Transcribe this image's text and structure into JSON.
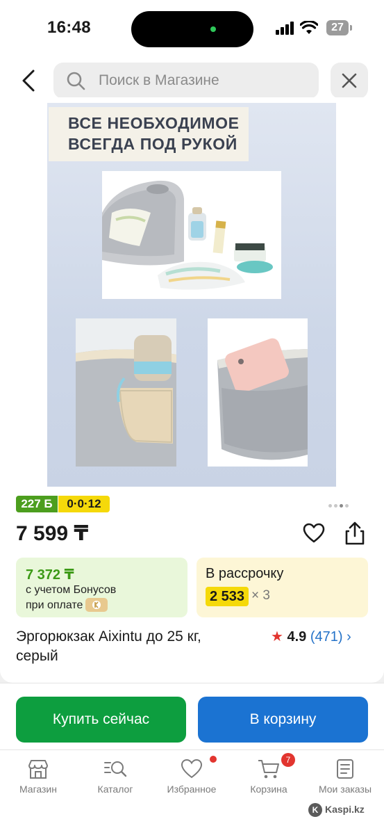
{
  "status_bar": {
    "time": "16:48",
    "battery": "27"
  },
  "header": {
    "search_placeholder": "Поиск в Магазине"
  },
  "gallery": {
    "image_caption_line1": "ВСЕ НЕОБХОДИМОЕ",
    "image_caption_line2": "ВСЕГДА ПОД РУКОЙ",
    "page_count": 4,
    "active_page": 3
  },
  "product": {
    "bonus_badge": "227 Б",
    "installment_badge": "0·0·12",
    "price": "7 599 ₸",
    "title": "Эргорюкзак Aixintu до 25 кг, серый",
    "rating": "4.9",
    "reviews": "(471)"
  },
  "bonus_offer": {
    "price": "7 372 ₸",
    "line1": "с учетом Бонусов",
    "line2": "при оплате"
  },
  "installment_offer": {
    "label": "В рассрочку",
    "amount": "2 533",
    "term": "× 3"
  },
  "actions": {
    "buy_now": "Купить сейчас",
    "add_to_cart": "В корзину"
  },
  "tabbar": {
    "items": [
      {
        "label": "Магазин",
        "icon": "shop-icon"
      },
      {
        "label": "Каталог",
        "icon": "catalog-search-icon"
      },
      {
        "label": "Избранное",
        "icon": "heart-icon"
      },
      {
        "label": "Корзина",
        "icon": "cart-icon"
      },
      {
        "label": "Мои заказы",
        "icon": "orders-icon"
      }
    ],
    "cart_count": "7"
  },
  "watermark": "Kaspi.kz",
  "colors": {
    "buy_green": "#0d9e3f",
    "cart_blue": "#1b73d2",
    "bonus_green": "#4c9e1e",
    "installment_yellow": "#f5d90a",
    "star_red": "#e2352f"
  }
}
